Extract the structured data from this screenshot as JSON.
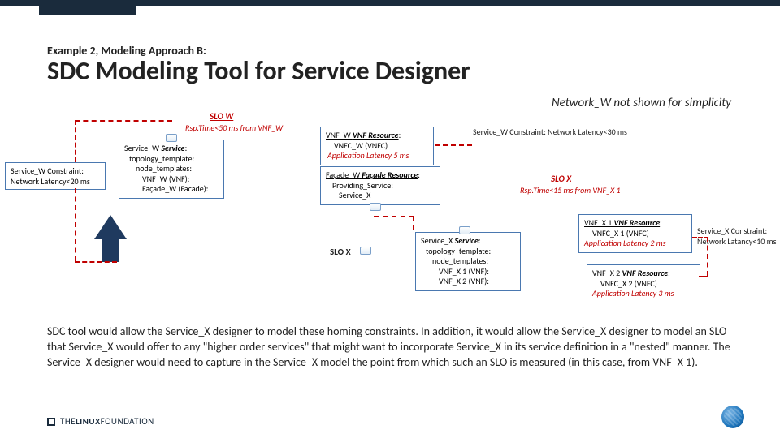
{
  "header": {
    "eyebrow": "Example 2, Modeling Approach B:",
    "title": "SDC Modeling Tool for Service Designer",
    "subtitle": "Network_W not shown for simplicity"
  },
  "slo_w": {
    "label": "SLO W",
    "detail": "Rsp.Time<50 ms from VNF_W"
  },
  "slo_x": {
    "label": "SLO X",
    "detail": "Rsp.Time<15 ms from VNF_X 1"
  },
  "slox_label": "SLO X",
  "constraints": {
    "w20": "Service_W Constraint: Network Latency<20 ms",
    "w30": "Service_W Constraint: Network Latency<30 ms",
    "x10": "Service_X Constraint: Network Latancy<10 ms"
  },
  "boxes": {
    "service_w": {
      "l1a": "Service_W ",
      "l1b": "Service",
      "l1c": ":",
      "l2": "topology_template:",
      "l3": "node_templates:",
      "l4": "VNF_W (VNF):",
      "l5": "Façade_W (Facade):"
    },
    "vnf_w": {
      "l1a": "VNF_W ",
      "l1b": "VNF Resource",
      "l1c": ":",
      "l2": "VNFC_W (VNFC)",
      "lat": "Application Latency 5 ms"
    },
    "facade_w": {
      "l1a": "Façade_W ",
      "l1b": "Façade Resource",
      "l1c": ":",
      "l2": "Providing_Service:",
      "l3": "Service_X"
    },
    "service_x": {
      "l1a": "Service_X ",
      "l1b": "Service",
      "l1c": ":",
      "l2": "topology_template:",
      "l3": "node_templates:",
      "l4": "VNF_X 1 (VNF):",
      "l5": "VNF_X 2 (VNF):"
    },
    "vnf_x1": {
      "l1a": "VNF_X 1 ",
      "l1b": "VNF Resource",
      "l1c": ":",
      "l2": "VNFC_X 1 (VNFC)",
      "lat": "Application Latency 2 ms"
    },
    "vnf_x2": {
      "l1a": "VNF_X 2 ",
      "l1b": "VNF Resource",
      "l1c": ":",
      "l2": "VNFC_X 2 (VNFC)",
      "lat": "Application Latency 3 ms"
    }
  },
  "paragraph": "SDC tool would allow the Service_X designer to model these homing constraints.  In addition, it would allow the Service_X designer to model an SLO that Service_X would offer to any \"higher order services\" that might want to incorporate Service_X in its service definition in a \"nested\" manner.  The Service_X designer would need to capture in the Service_X model the point from which such an SLO is measured (in this case, from VNF_X 1).",
  "footer": {
    "brand_a": "THE",
    "brand_b": "LINUX",
    "brand_c": "FOUNDATION"
  }
}
